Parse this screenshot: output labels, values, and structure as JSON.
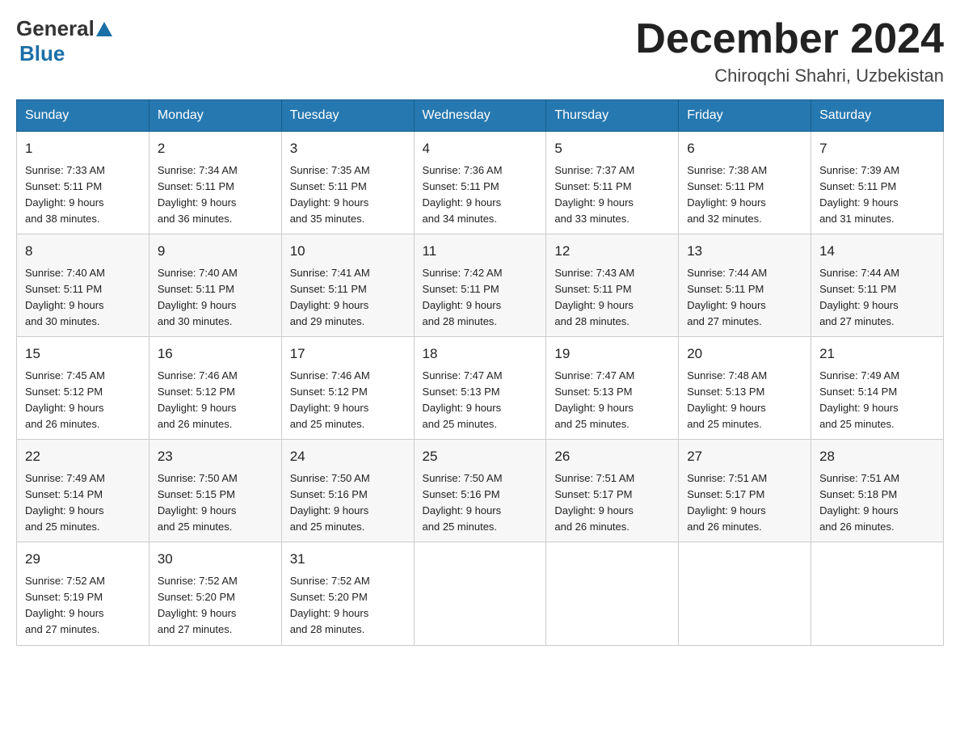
{
  "header": {
    "logo_general": "General",
    "logo_blue": "Blue",
    "month_title": "December 2024",
    "location": "Chiroqchi Shahri, Uzbekistan"
  },
  "days_of_week": [
    "Sunday",
    "Monday",
    "Tuesday",
    "Wednesday",
    "Thursday",
    "Friday",
    "Saturday"
  ],
  "weeks": [
    [
      {
        "day": "1",
        "sunrise": "7:33 AM",
        "sunset": "5:11 PM",
        "daylight": "9 hours and 38 minutes."
      },
      {
        "day": "2",
        "sunrise": "7:34 AM",
        "sunset": "5:11 PM",
        "daylight": "9 hours and 36 minutes."
      },
      {
        "day": "3",
        "sunrise": "7:35 AM",
        "sunset": "5:11 PM",
        "daylight": "9 hours and 35 minutes."
      },
      {
        "day": "4",
        "sunrise": "7:36 AM",
        "sunset": "5:11 PM",
        "daylight": "9 hours and 34 minutes."
      },
      {
        "day": "5",
        "sunrise": "7:37 AM",
        "sunset": "5:11 PM",
        "daylight": "9 hours and 33 minutes."
      },
      {
        "day": "6",
        "sunrise": "7:38 AM",
        "sunset": "5:11 PM",
        "daylight": "9 hours and 32 minutes."
      },
      {
        "day": "7",
        "sunrise": "7:39 AM",
        "sunset": "5:11 PM",
        "daylight": "9 hours and 31 minutes."
      }
    ],
    [
      {
        "day": "8",
        "sunrise": "7:40 AM",
        "sunset": "5:11 PM",
        "daylight": "9 hours and 30 minutes."
      },
      {
        "day": "9",
        "sunrise": "7:40 AM",
        "sunset": "5:11 PM",
        "daylight": "9 hours and 30 minutes."
      },
      {
        "day": "10",
        "sunrise": "7:41 AM",
        "sunset": "5:11 PM",
        "daylight": "9 hours and 29 minutes."
      },
      {
        "day": "11",
        "sunrise": "7:42 AM",
        "sunset": "5:11 PM",
        "daylight": "9 hours and 28 minutes."
      },
      {
        "day": "12",
        "sunrise": "7:43 AM",
        "sunset": "5:11 PM",
        "daylight": "9 hours and 28 minutes."
      },
      {
        "day": "13",
        "sunrise": "7:44 AM",
        "sunset": "5:11 PM",
        "daylight": "9 hours and 27 minutes."
      },
      {
        "day": "14",
        "sunrise": "7:44 AM",
        "sunset": "5:11 PM",
        "daylight": "9 hours and 27 minutes."
      }
    ],
    [
      {
        "day": "15",
        "sunrise": "7:45 AM",
        "sunset": "5:12 PM",
        "daylight": "9 hours and 26 minutes."
      },
      {
        "day": "16",
        "sunrise": "7:46 AM",
        "sunset": "5:12 PM",
        "daylight": "9 hours and 26 minutes."
      },
      {
        "day": "17",
        "sunrise": "7:46 AM",
        "sunset": "5:12 PM",
        "daylight": "9 hours and 25 minutes."
      },
      {
        "day": "18",
        "sunrise": "7:47 AM",
        "sunset": "5:13 PM",
        "daylight": "9 hours and 25 minutes."
      },
      {
        "day": "19",
        "sunrise": "7:47 AM",
        "sunset": "5:13 PM",
        "daylight": "9 hours and 25 minutes."
      },
      {
        "day": "20",
        "sunrise": "7:48 AM",
        "sunset": "5:13 PM",
        "daylight": "9 hours and 25 minutes."
      },
      {
        "day": "21",
        "sunrise": "7:49 AM",
        "sunset": "5:14 PM",
        "daylight": "9 hours and 25 minutes."
      }
    ],
    [
      {
        "day": "22",
        "sunrise": "7:49 AM",
        "sunset": "5:14 PM",
        "daylight": "9 hours and 25 minutes."
      },
      {
        "day": "23",
        "sunrise": "7:50 AM",
        "sunset": "5:15 PM",
        "daylight": "9 hours and 25 minutes."
      },
      {
        "day": "24",
        "sunrise": "7:50 AM",
        "sunset": "5:16 PM",
        "daylight": "9 hours and 25 minutes."
      },
      {
        "day": "25",
        "sunrise": "7:50 AM",
        "sunset": "5:16 PM",
        "daylight": "9 hours and 25 minutes."
      },
      {
        "day": "26",
        "sunrise": "7:51 AM",
        "sunset": "5:17 PM",
        "daylight": "9 hours and 26 minutes."
      },
      {
        "day": "27",
        "sunrise": "7:51 AM",
        "sunset": "5:17 PM",
        "daylight": "9 hours and 26 minutes."
      },
      {
        "day": "28",
        "sunrise": "7:51 AM",
        "sunset": "5:18 PM",
        "daylight": "9 hours and 26 minutes."
      }
    ],
    [
      {
        "day": "29",
        "sunrise": "7:52 AM",
        "sunset": "5:19 PM",
        "daylight": "9 hours and 27 minutes."
      },
      {
        "day": "30",
        "sunrise": "7:52 AM",
        "sunset": "5:20 PM",
        "daylight": "9 hours and 27 minutes."
      },
      {
        "day": "31",
        "sunrise": "7:52 AM",
        "sunset": "5:20 PM",
        "daylight": "9 hours and 28 minutes."
      },
      null,
      null,
      null,
      null
    ]
  ],
  "labels": {
    "sunrise": "Sunrise:",
    "sunset": "Sunset:",
    "daylight": "Daylight:"
  },
  "accent_color": "#2678b0"
}
